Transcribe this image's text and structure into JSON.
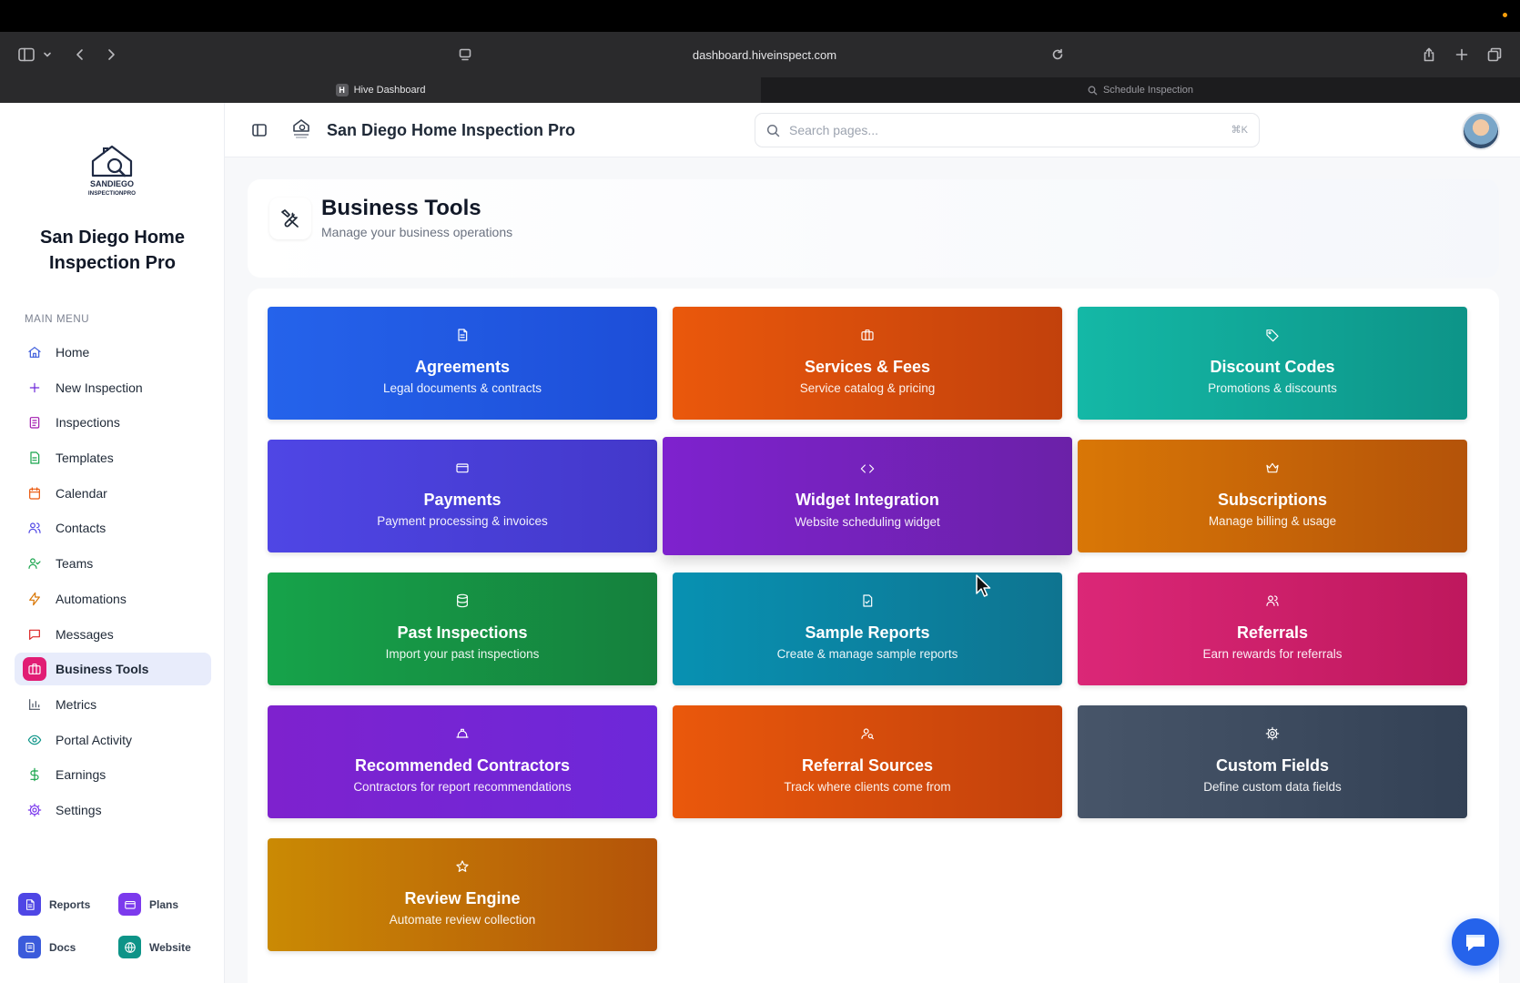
{
  "browser": {
    "address": "dashboard.hiveinspect.com",
    "tabs": [
      {
        "label": "Hive Dashboard",
        "favicon": "H",
        "active": true
      },
      {
        "label": "Schedule Inspection",
        "active": false
      }
    ]
  },
  "sidebar": {
    "org_name": "San Diego Home Inspection Pro",
    "logo_text_line1": "SANDIEGO",
    "logo_text_line2": "INSPECTIONPRO",
    "menu_label": "MAIN MENU",
    "items": [
      {
        "label": "Home",
        "icon": "home-icon",
        "color": "#3b5bdb"
      },
      {
        "label": "New Inspection",
        "icon": "plus-icon",
        "color": "#6d28d9"
      },
      {
        "label": "Inspections",
        "icon": "clipboard-icon",
        "color": "#a21caf"
      },
      {
        "label": "Templates",
        "icon": "file-icon",
        "color": "#16a34a"
      },
      {
        "label": "Calendar",
        "icon": "calendar-icon",
        "color": "#ea580c"
      },
      {
        "label": "Contacts",
        "icon": "users-icon",
        "color": "#4f46e5"
      },
      {
        "label": "Teams",
        "icon": "user-check-icon",
        "color": "#16a34a"
      },
      {
        "label": "Automations",
        "icon": "zap-icon",
        "color": "#d97706"
      },
      {
        "label": "Messages",
        "icon": "message-icon",
        "color": "#dc2626"
      },
      {
        "label": "Business Tools",
        "icon": "briefcase-icon",
        "color": "#e11d74",
        "active": true
      },
      {
        "label": "Metrics",
        "icon": "bar-chart-icon",
        "color": "#4b5563"
      },
      {
        "label": "Portal Activity",
        "icon": "eye-icon",
        "color": "#0d9488"
      },
      {
        "label": "Earnings",
        "icon": "dollar-icon",
        "color": "#16a34a"
      },
      {
        "label": "Settings",
        "icon": "gear-icon",
        "color": "#7c3aed"
      }
    ],
    "bottom_links": [
      {
        "label": "Reports",
        "icon": "document-icon",
        "color": "#4f46e5"
      },
      {
        "label": "Plans",
        "icon": "card-icon",
        "color": "#7c3aed"
      },
      {
        "label": "Docs",
        "icon": "book-icon",
        "color": "#3b5bdb"
      },
      {
        "label": "Website",
        "icon": "globe-icon",
        "color": "#0d9488"
      }
    ]
  },
  "header": {
    "title": "San Diego Home Inspection Pro",
    "search_placeholder": "Search pages...",
    "search_shortcut": "⌘K"
  },
  "page": {
    "title": "Business Tools",
    "subtitle": "Manage your business operations"
  },
  "tools": [
    {
      "title": "Agreements",
      "subtitle": "Legal documents & contracts",
      "icon": "document-icon",
      "color_from": "#2563eb",
      "color_to": "#1d4ed8"
    },
    {
      "title": "Services & Fees",
      "subtitle": "Service catalog & pricing",
      "icon": "briefcase-icon",
      "color_from": "#ea580c",
      "color_to": "#c2410c"
    },
    {
      "title": "Discount Codes",
      "subtitle": "Promotions & discounts",
      "icon": "tag-icon",
      "color_from": "#14b8a6",
      "color_to": "#0d9488"
    },
    {
      "title": "Payments",
      "subtitle": "Payment processing & invoices",
      "icon": "card-icon",
      "color_from": "#4f46e5",
      "color_to": "#4338ca"
    },
    {
      "title": "Widget Integration",
      "subtitle": "Website scheduling widget",
      "icon": "code-icon",
      "color_from": "#7e22ce",
      "color_to": "#6b21a8"
    },
    {
      "title": "Subscriptions",
      "subtitle": "Manage billing & usage",
      "icon": "crown-icon",
      "color_from": "#d97706",
      "color_to": "#b45309"
    },
    {
      "title": "Past Inspections",
      "subtitle": "Import your past inspections",
      "icon": "database-icon",
      "color_from": "#16a34a",
      "color_to": "#15803d"
    },
    {
      "title": "Sample Reports",
      "subtitle": "Create & manage sample reports",
      "icon": "file-check-icon",
      "color_from": "#0891b2",
      "color_to": "#0e7490"
    },
    {
      "title": "Referrals",
      "subtitle": "Earn rewards for referrals",
      "icon": "users-icon",
      "color_from": "#db2777",
      "color_to": "#be185d"
    },
    {
      "title": "Recommended Contractors",
      "subtitle": "Contractors for report recommendations",
      "icon": "hardhat-icon",
      "color_from": "#7e22ce",
      "color_to": "#6d28d9"
    },
    {
      "title": "Referral Sources",
      "subtitle": "Track where clients come from",
      "icon": "user-search-icon",
      "color_from": "#ea580c",
      "color_to": "#c2410c"
    },
    {
      "title": "Custom Fields",
      "subtitle": "Define custom data fields",
      "icon": "gear-icon",
      "color_from": "#475569",
      "color_to": "#334155"
    },
    {
      "title": "Review Engine",
      "subtitle": "Automate review collection",
      "icon": "star-icon",
      "color_from": "#ca8a04",
      "color_to": "#b45309"
    }
  ]
}
